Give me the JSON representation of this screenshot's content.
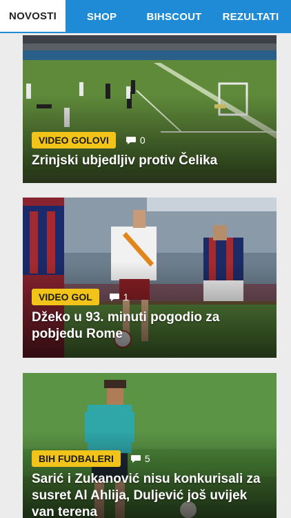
{
  "nav": {
    "tabs": [
      {
        "label": "NOVOSTI",
        "active": true
      },
      {
        "label": "SHOP",
        "active": false
      },
      {
        "label": "BIHSCOUT",
        "active": false
      },
      {
        "label": "REZULTATI",
        "active": false
      }
    ]
  },
  "articles": [
    {
      "category": "VIDEO GOLOVI",
      "comments": "0",
      "title": "Zrinjski ubjedljiv protiv Čelika"
    },
    {
      "category": "VIDEO GOL",
      "comments": "1",
      "title": "Džeko u 93. minuti pogodio za pobjedu Rome"
    },
    {
      "category": "BIH FUDBALERI",
      "comments": "5",
      "title": "Sarić i Zukanović nisu konkurisali za susret Al Ahlija, Duljević još uvijek van terena"
    }
  ],
  "colors": {
    "nav_bg": "#1f8bd6",
    "badge_bg": "#f2c318",
    "page_bg": "#ececec"
  },
  "icons": {
    "comment": "comment-icon"
  }
}
